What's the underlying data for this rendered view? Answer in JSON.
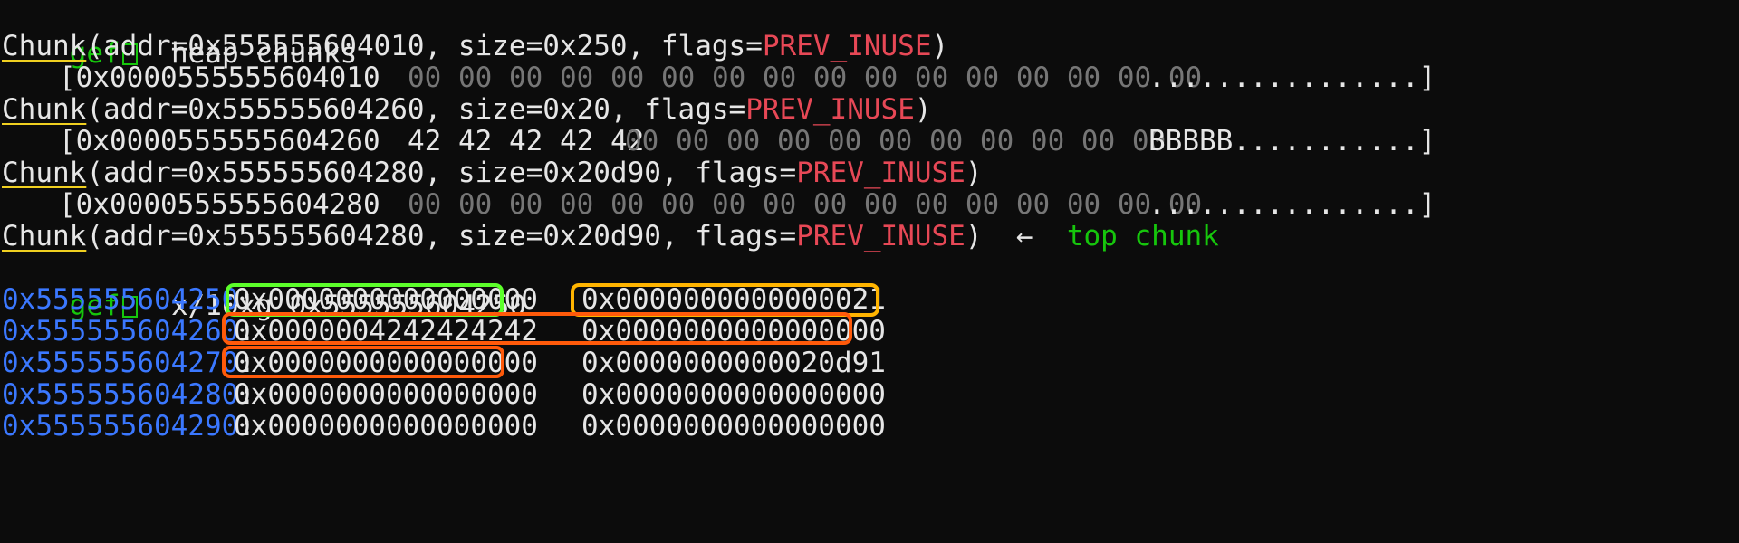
{
  "terminal": {
    "prompt_word": "gef",
    "commands": [
      "heap chunks",
      "x/10xg 0x555555604250"
    ],
    "chunks": [
      {
        "word": "Chunk",
        "params": "(addr=0x555555604010, size=0x250, flags=",
        "flag": "PREV_INUSE",
        "close": ")",
        "dump": {
          "addr": "[0x0000555555604010",
          "bytes_hi": "",
          "bytes_lo": "00 00 00 00 00 00 00 00 00 00 00 00 00 00 00 00",
          "ascii": "................]"
        }
      },
      {
        "word": "Chunk",
        "params": "(addr=0x555555604260, size=0x20, flags=",
        "flag": "PREV_INUSE",
        "close": ")",
        "dump": {
          "addr": "[0x0000555555604260",
          "bytes_hi": "42 42 42 42 42",
          "bytes_lo": "00 00 00 00 00 00 00 00 00 00 00",
          "ascii": "BBBBB...........]"
        }
      },
      {
        "word": "Chunk",
        "params": "(addr=0x555555604280, size=0x20d90, flags=",
        "flag": "PREV_INUSE",
        "close": ")",
        "dump": {
          "addr": "[0x0000555555604280",
          "bytes_hi": "",
          "bytes_lo": "00 00 00 00 00 00 00 00 00 00 00 00 00 00 00 00",
          "ascii": "................]"
        }
      }
    ],
    "top_chunk": {
      "word": "Chunk",
      "params": "(addr=0x555555604280, size=0x20d90, flags=",
      "flag": "PREV_INUSE",
      "close": ")",
      "arrow": "←",
      "label": "top chunk"
    },
    "memory": [
      {
        "addr": "0x555555604250",
        "v1": "0x0000000000000000",
        "v2": "0x0000000000000021"
      },
      {
        "addr": "0x555555604260",
        "v1": "0x0000004242424242",
        "v2": "0x0000000000000000"
      },
      {
        "addr": "0x555555604270",
        "v1": "0x0000000000000000",
        "v2": "0x0000000000020d91"
      },
      {
        "addr": "0x555555604280",
        "v1": "0x0000000000000000",
        "v2": "0x0000000000000000"
      },
      {
        "addr": "0x555555604290",
        "v1": "0x0000000000000000",
        "v2": "0x0000000000000000"
      }
    ],
    "colors": {
      "background": "#0c0c0c",
      "text": "#e6e6e6",
      "prompt": "#16c60c",
      "flag": "#e74856",
      "address": "#3b78ff",
      "muted_bytes": "#767676",
      "chunk_underline": "#f0d020",
      "highlight_green": "#5cff2a",
      "highlight_yellow": "#ffb400",
      "highlight_orange": "#ff5a0a"
    }
  }
}
